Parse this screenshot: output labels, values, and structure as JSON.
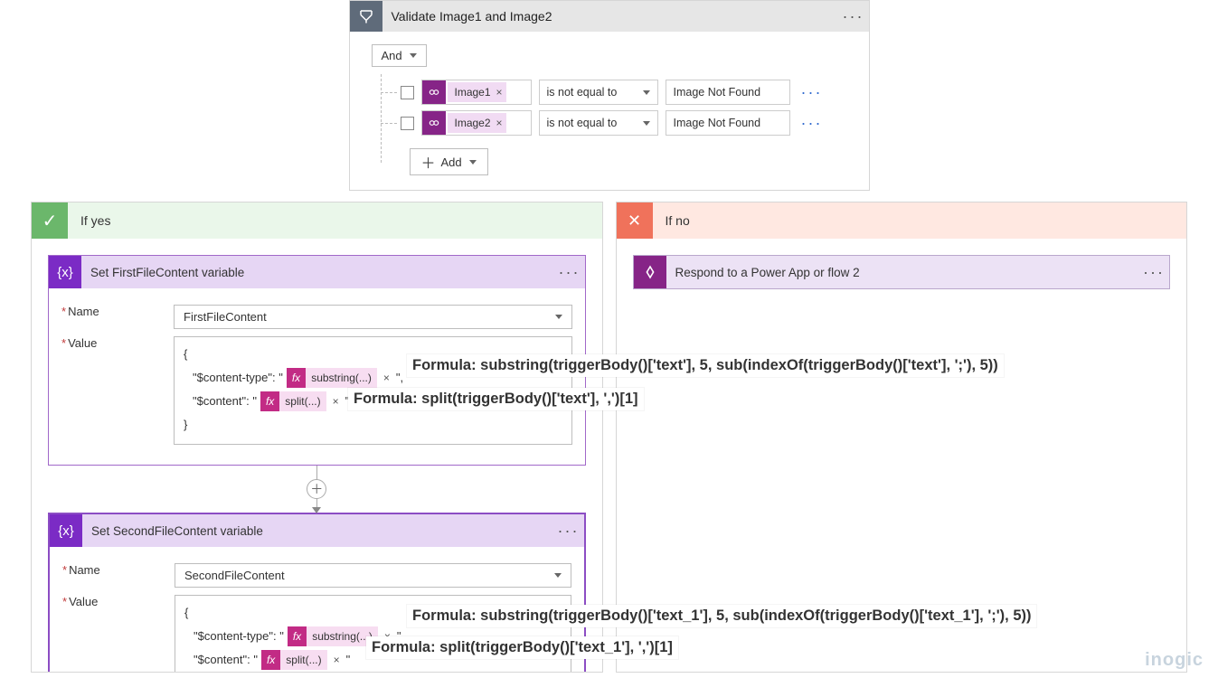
{
  "condition": {
    "title": "Validate Image1 and Image2",
    "logic": "And",
    "add_label": "Add",
    "rows": [
      {
        "token": "Image1",
        "operator": "is not equal to",
        "value": "Image Not Found"
      },
      {
        "token": "Image2",
        "operator": "is not equal to",
        "value": "Image Not Found"
      }
    ]
  },
  "branches": {
    "yes": {
      "title": "If yes"
    },
    "no": {
      "title": "If no"
    }
  },
  "actions": {
    "setFirst": {
      "title": "Set FirstFileContent variable",
      "name_label": "Name",
      "value_label": "Value",
      "name_value": "FirstFileContent",
      "body": {
        "open": "{",
        "close": "}",
        "line1_key": "\"$content-type\": \"",
        "line1_fx": "substring(...)",
        "line1_tail": "\",",
        "line2_key": "\"$content\": \"",
        "line2_fx": "split(...)",
        "line2_tail": "\""
      },
      "formula1": "Formula: substring(triggerBody()['text'], 5, sub(indexOf(triggerBody()['text'], ';'), 5))",
      "formula2": "Formula: split(triggerBody()['text'], ',')[1]"
    },
    "setSecond": {
      "title": "Set SecondFileContent variable",
      "name_label": "Name",
      "value_label": "Value",
      "name_value": "SecondFileContent",
      "body": {
        "open": "{",
        "line1_key": "\"$content-type\": \"",
        "line1_fx": "substring(...)",
        "line1_tail": "\",",
        "line2_key": "\"$content\": \"",
        "line2_fx": "split(...)",
        "line2_tail": "\""
      },
      "formula1": "Formula: substring(triggerBody()['text_1'], 5, sub(indexOf(triggerBody()['text_1'], ';'), 5))",
      "formula2": "Formula: split(triggerBody()['text_1'], ',')[1]"
    },
    "respond": {
      "title": "Respond to a Power App or flow 2"
    }
  },
  "watermark": "inogic"
}
